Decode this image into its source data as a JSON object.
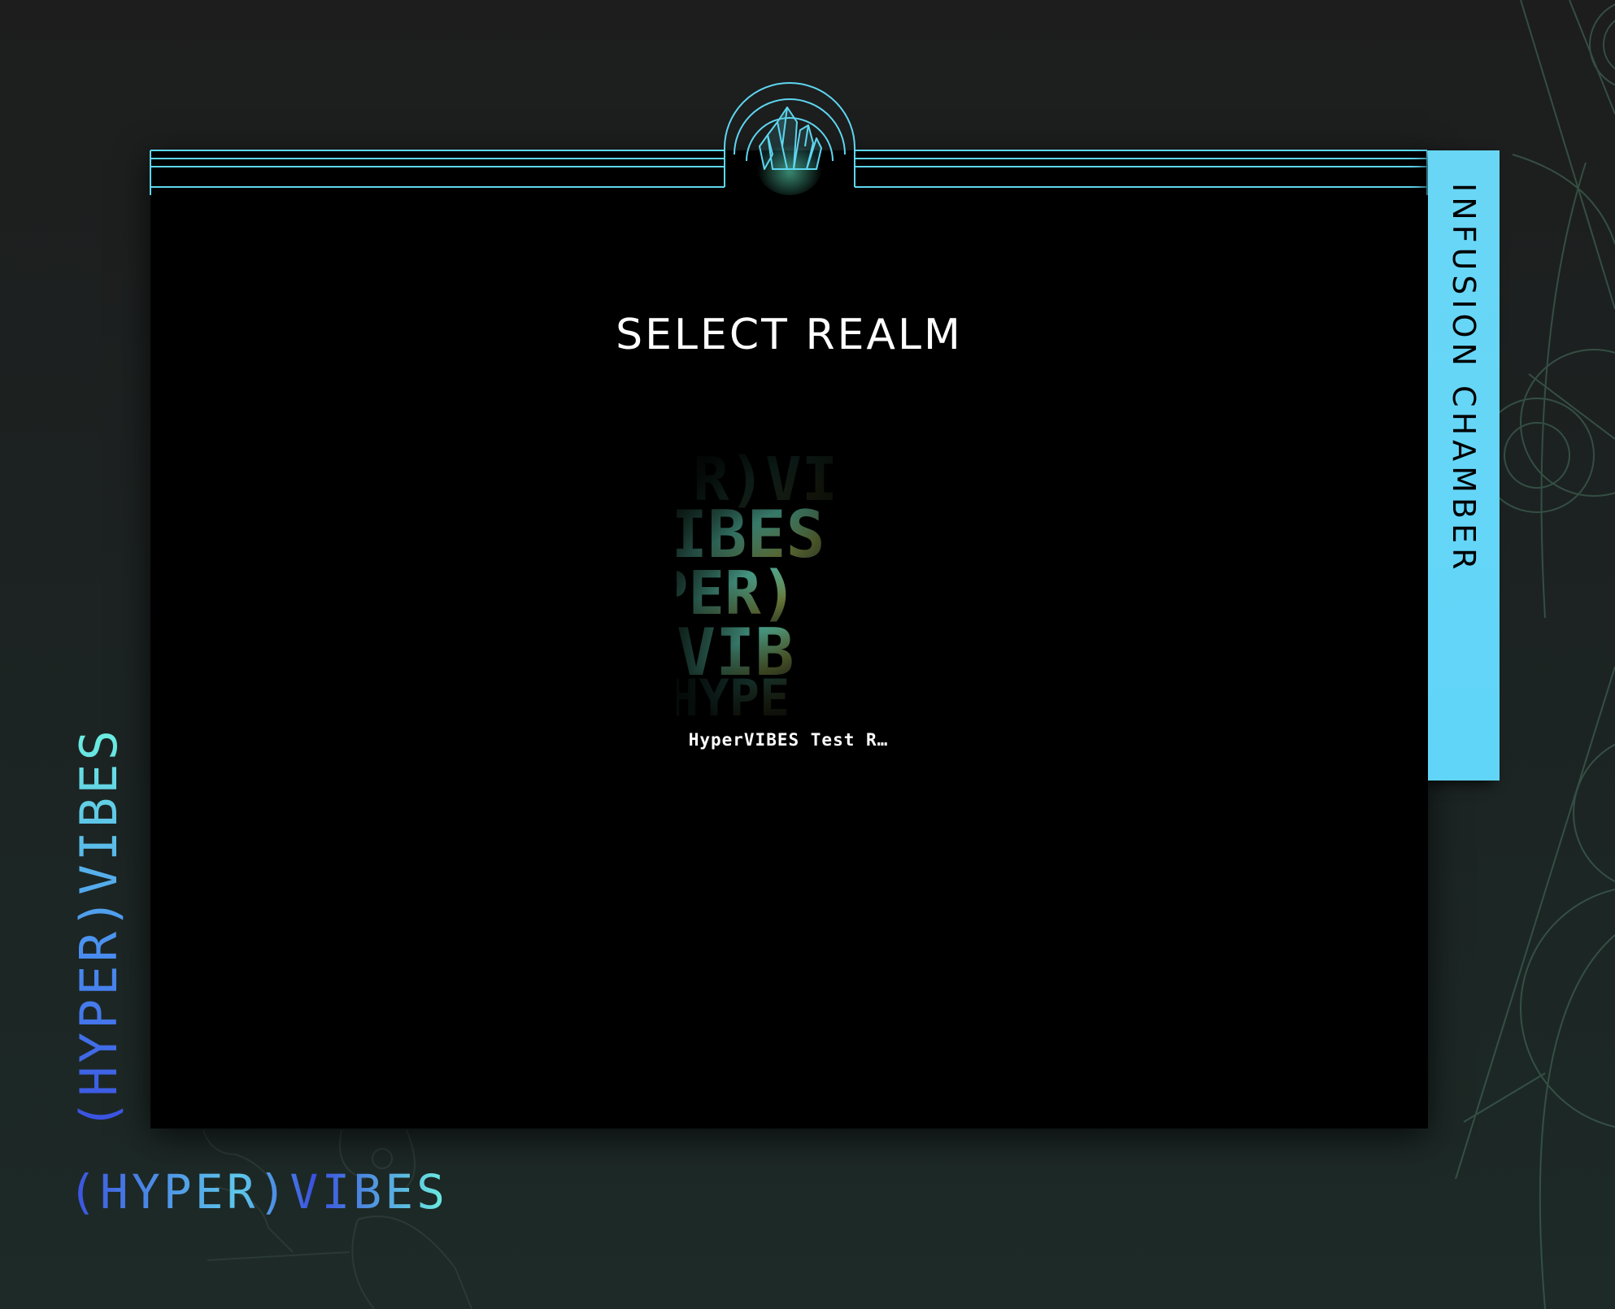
{
  "header": {
    "title": "SELECT REALM",
    "emblem_icon": "crystal-icon"
  },
  "side_tab": {
    "label": "INFUSION CHAMBER"
  },
  "realms": [
    {
      "name": "HyperVIBES Test R…",
      "thumbnail_text": "(HYPER)VIBES"
    }
  ],
  "brand": {
    "vertical_wordmark": "(HYPER)VIBES",
    "horizontal_wordmark": "(HYPER)VIBES"
  },
  "colors": {
    "accent_cyan": "#60d5f8",
    "brand_blue": "#3a4fe0",
    "brand_mint": "#6df0e0",
    "frame_bg": "#000000"
  }
}
